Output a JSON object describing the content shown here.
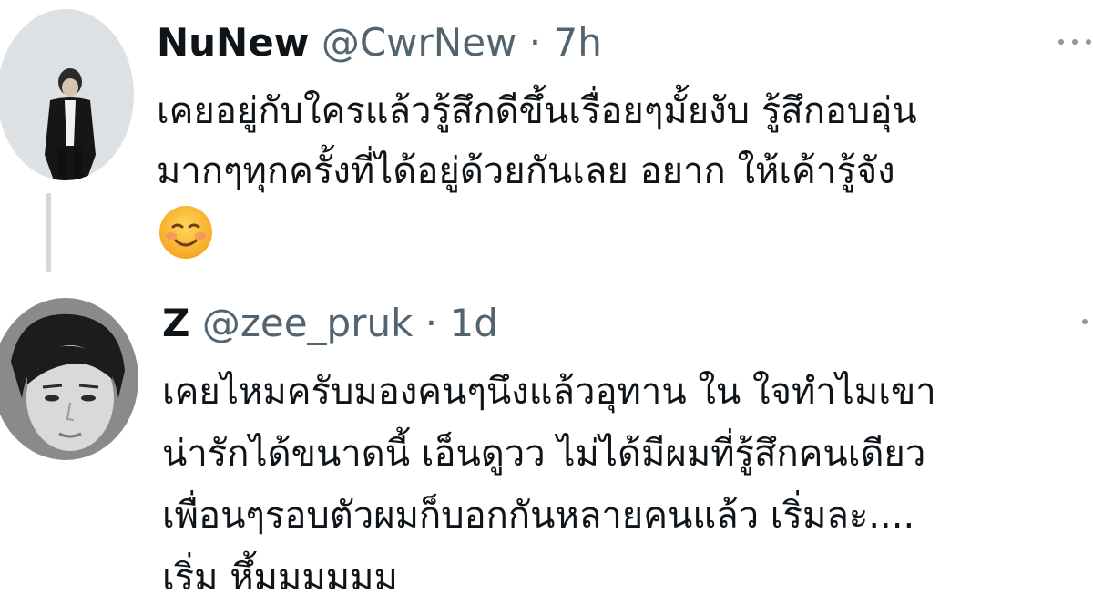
{
  "tweets": [
    {
      "display_name": "NuNew",
      "handle": "@CwrNew",
      "separator": "·",
      "time": "7h",
      "avatar_icon": "profile-photo-standing-person",
      "text_lines": [
        "เคยอยู่กับใครแล้วรู้สึกดีขึ้นเรื่อยๆมั้ยงับ รู้สึกอบอุ่น",
        "มากๆทุกครั้งที่ได้อยู่ด้วยกันเลย อยาก ให้เค้ารู้จัง"
      ],
      "emoji": "☺️"
    },
    {
      "display_name": "Z",
      "handle": "@zee_pruk",
      "separator": "·",
      "time": "1d",
      "avatar_icon": "profile-photo-portrait-bw",
      "text_lines": [
        "เคยไหมครับมองคนๆนึงแล้วอุทาน ใน ใจทำไมเขา",
        "น่ารักได้ขนาดนี้ เอ็นดูวว ไม่ได้มีผมที่รู้สึกคนเดียว",
        "เพื่อนๆรอบตัวผมก็บอกกันหลายคนแล้ว เริ่มละ....",
        "เริ่ม หึ้มมมมมม"
      ]
    }
  ],
  "colors": {
    "text_primary": "#0f1419",
    "text_secondary": "#536471",
    "thread_line": "#cfd9de"
  }
}
